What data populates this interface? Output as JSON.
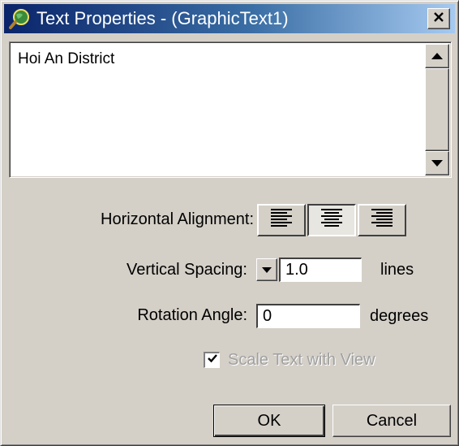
{
  "window": {
    "title": "Text Properties - (GraphicText1)"
  },
  "text_area": {
    "value": "Hoi An District"
  },
  "horizontal_alignment": {
    "label": "Horizontal Alignment:",
    "options": [
      "left",
      "center",
      "right"
    ],
    "selected": "center"
  },
  "vertical_spacing": {
    "label": "Vertical Spacing:",
    "value": "1.0",
    "unit": "lines"
  },
  "rotation_angle": {
    "label": "Rotation Angle:",
    "value": "0",
    "unit": "degrees"
  },
  "scale_text": {
    "label": "Scale Text with View",
    "checked": true,
    "enabled": false
  },
  "buttons": {
    "ok": "OK",
    "cancel": "Cancel"
  },
  "icons": {
    "title": "magnifier-globe-icon",
    "close": "close-icon",
    "scroll_up": "arrow-up-icon",
    "scroll_down": "arrow-down-icon",
    "dropdown": "chevron-down-icon"
  },
  "colors": {
    "titlebar_start": "#0a246a",
    "titlebar_end": "#a6caf0",
    "dialog_face": "#d4d0c8"
  }
}
